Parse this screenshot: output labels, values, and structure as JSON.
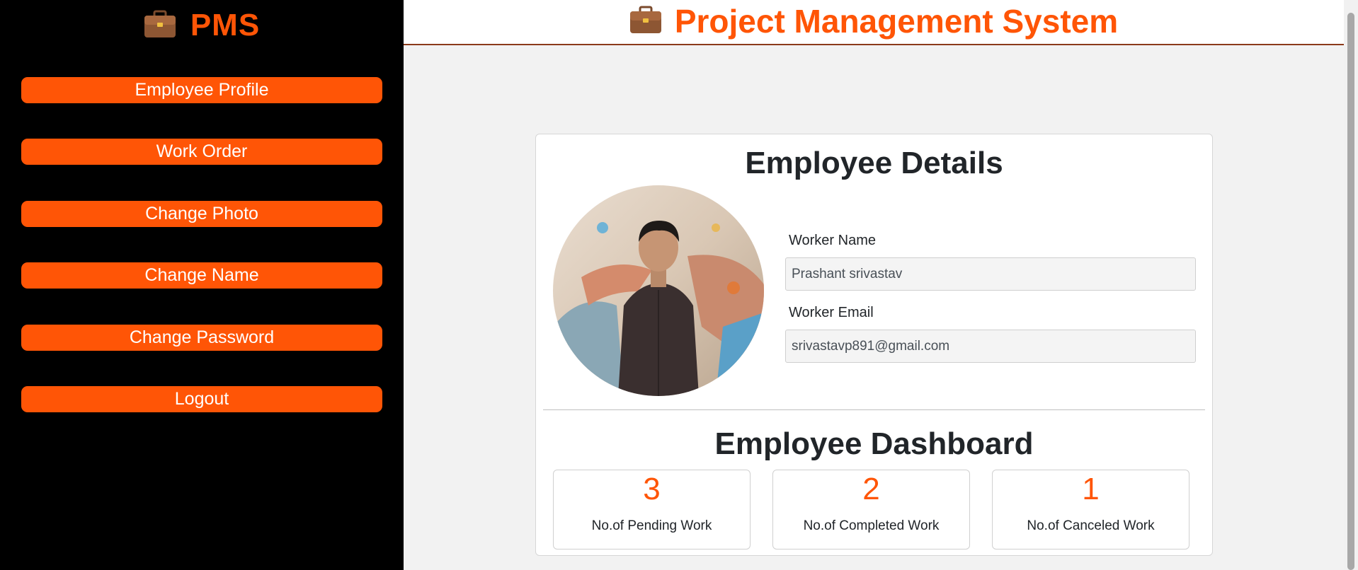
{
  "sidebar": {
    "brand": "PMS",
    "brand_icon": "briefcase-icon",
    "items": [
      {
        "label": "Employee Profile"
      },
      {
        "label": "Work Order"
      },
      {
        "label": "Change Photo"
      },
      {
        "label": "Change Name"
      },
      {
        "label": "Change Password"
      },
      {
        "label": "Logout"
      }
    ]
  },
  "header": {
    "title": "Project Management System",
    "icon": "briefcase-icon"
  },
  "details": {
    "title": "Employee Details",
    "worker_name_label": "Worker Name",
    "worker_name_value": "Prashant srivastav",
    "worker_email_label": "Worker Email",
    "worker_email_value": "srivastavp891@gmail.com"
  },
  "dashboard": {
    "title": "Employee Dashboard",
    "stats": [
      {
        "value": "3",
        "label": "No.of Pending Work"
      },
      {
        "value": "2",
        "label": "No.of Completed Work"
      },
      {
        "value": "1",
        "label": "No.of Canceled Work"
      }
    ]
  },
  "colors": {
    "accent": "#ff5506",
    "sidebar_bg": "#000000",
    "page_bg": "#f2f2f2"
  }
}
